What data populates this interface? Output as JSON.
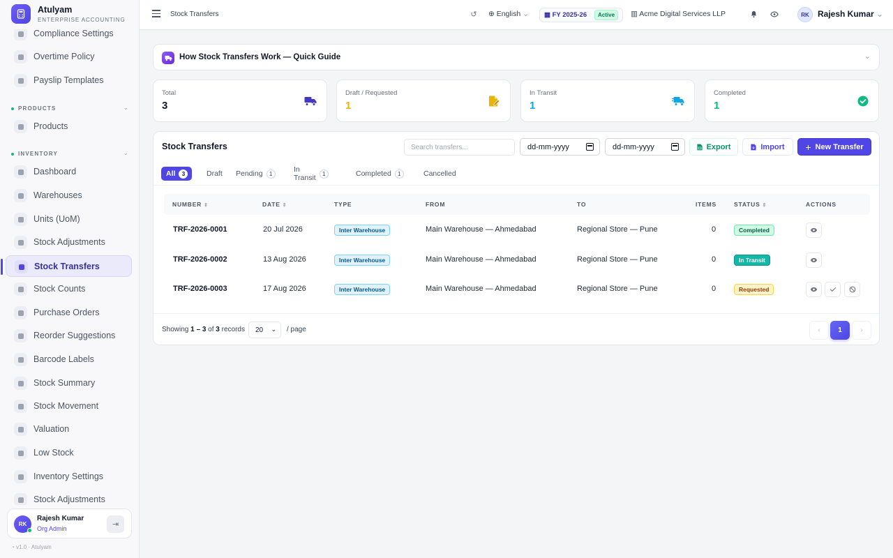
{
  "brand": {
    "name": "Atulyam",
    "subtitle": "ENTERPRISE ACCOUNTING"
  },
  "sidebar": {
    "items_top": [
      {
        "label": "Compliance Settings",
        "icon": "shield-icon"
      },
      {
        "label": "Overtime Policy",
        "icon": "clock-icon"
      },
      {
        "label": "Payslip Templates",
        "icon": "document-icon"
      }
    ],
    "section_products": "PRODUCTS",
    "products_items": [
      {
        "label": "Products",
        "icon": "box-icon"
      }
    ],
    "section_inventory": "INVENTORY",
    "inventory_items": [
      {
        "label": "Dashboard",
        "icon": "dashboard-icon"
      },
      {
        "label": "Warehouses",
        "icon": "warehouse-icon"
      },
      {
        "label": "Units (UoM)",
        "icon": "ruler-icon"
      },
      {
        "label": "Stock Adjustments",
        "icon": "sliders-icon"
      },
      {
        "label": "Stock Transfers",
        "icon": "truck-icon",
        "active": true
      },
      {
        "label": "Stock Counts",
        "icon": "clipboard-icon"
      },
      {
        "label": "Purchase Orders",
        "icon": "file-icon"
      },
      {
        "label": "Reorder Suggestions",
        "icon": "bell-icon"
      },
      {
        "label": "Barcode Labels",
        "icon": "barcode-icon"
      },
      {
        "label": "Stock Summary",
        "icon": "bar-chart-icon"
      },
      {
        "label": "Stock Movement",
        "icon": "refresh-icon"
      },
      {
        "label": "Valuation",
        "icon": "coins-icon"
      },
      {
        "label": "Low Stock",
        "icon": "warning-icon"
      },
      {
        "label": "Inventory Settings",
        "icon": "gears-icon"
      },
      {
        "label": "Stock Adjustments",
        "icon": "sliders-icon"
      }
    ],
    "user": {
      "initials": "RK",
      "name": "Rajesh Kumar",
      "role": "Org Admin"
    },
    "version": "v1.0 · Atulyam"
  },
  "topbar": {
    "breadcrumb": "Stock Transfers",
    "language": "English",
    "fy": "FY 2025-26",
    "fy_status": "Active",
    "company": "Acme Digital Services LLP",
    "user_initials": "RK",
    "user_name": "Rajesh Kumar"
  },
  "guide": {
    "title": "How Stock Transfers Work — Quick Guide"
  },
  "stats": [
    {
      "label": "Total",
      "value": "3",
      "color": "#111827",
      "icon_color": "#4338ca"
    },
    {
      "label": "Draft / Requested",
      "value": "1",
      "color": "#eab308",
      "icon_color": "#eab308"
    },
    {
      "label": "In Transit",
      "value": "1",
      "color": "#0ea5e9",
      "icon_color": "#0ea5e9"
    },
    {
      "label": "Completed",
      "value": "1",
      "color": "#10b981",
      "icon_color": "#10b981"
    }
  ],
  "panel": {
    "title": "Stock Transfers",
    "search_placeholder": "Search transfers...",
    "date_from": "dd-mm-yyyy",
    "date_to": "dd-mm-yyyy",
    "export_label": "Export",
    "import_label": "Import",
    "new_label": "New Transfer"
  },
  "tabs": [
    {
      "label": "All",
      "count": "3"
    },
    {
      "label": "Draft",
      "count": ""
    },
    {
      "label": "Pending",
      "count": "1"
    },
    {
      "label": "In Transit",
      "count": "1"
    },
    {
      "label": "Completed",
      "count": "1"
    },
    {
      "label": "Cancelled",
      "count": ""
    }
  ],
  "table": {
    "headers": [
      "NUMBER",
      "DATE",
      "TYPE",
      "FROM",
      "TO",
      "ITEMS",
      "STATUS",
      "ACTIONS"
    ],
    "rows": [
      {
        "number": "TRF-2026-0001",
        "date": "20 Jul 2026",
        "type": "Inter Warehouse",
        "from": "Main Warehouse — Ahmedabad",
        "to": "Regional Store — Pune",
        "items": "0",
        "status": "Completed"
      },
      {
        "number": "TRF-2026-0002",
        "date": "13 Aug 2026",
        "type": "Inter Warehouse",
        "from": "Main Warehouse — Ahmedabad",
        "to": "Regional Store — Pune",
        "items": "0",
        "status": "In Transit"
      },
      {
        "number": "TRF-2026-0003",
        "date": "17 Aug 2026",
        "type": "Inter Warehouse",
        "from": "Main Warehouse — Ahmedabad",
        "to": "Regional Store — Pune",
        "items": "0",
        "status": "Requested"
      }
    ]
  },
  "footer": {
    "showing_prefix": "Showing",
    "range": "1 – 3",
    "of": "of",
    "total": "3",
    "records": "records",
    "per_page": "20",
    "per_page_label": "/ page",
    "current_page": "1"
  }
}
